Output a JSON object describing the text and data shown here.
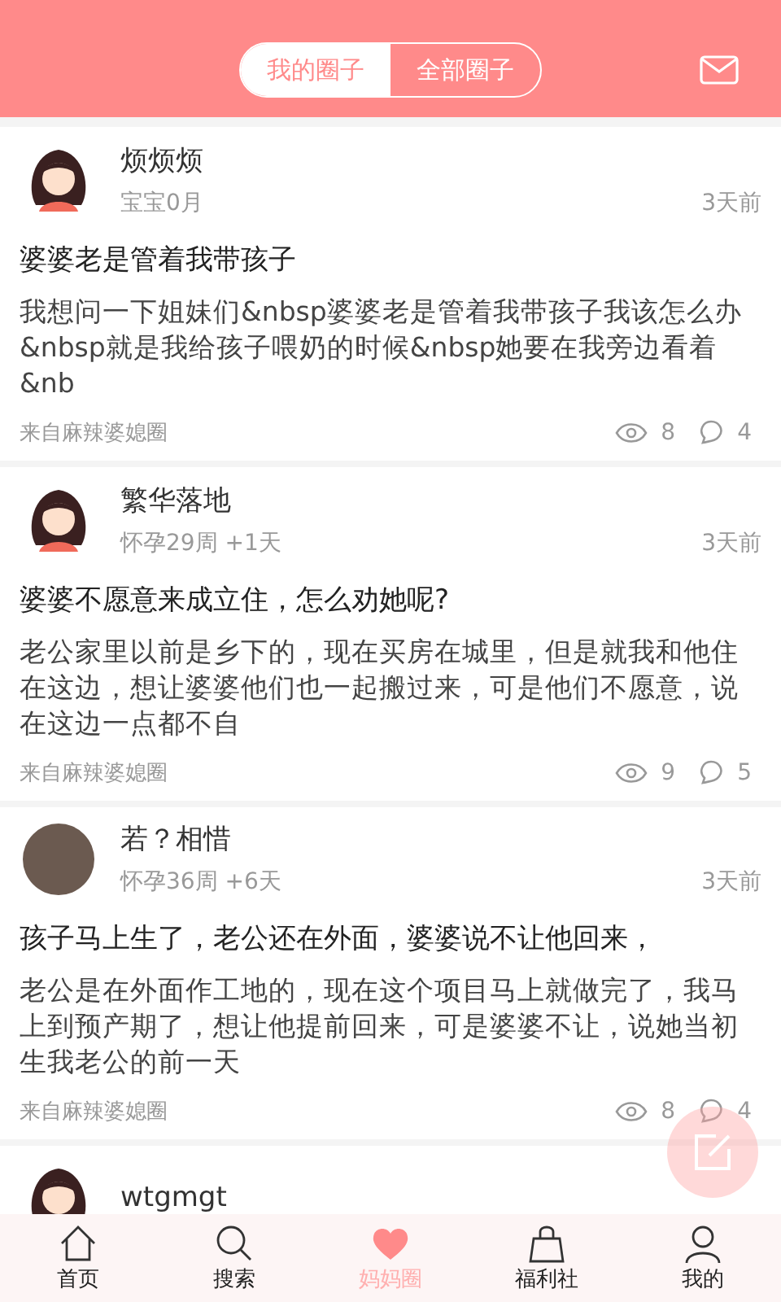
{
  "header": {
    "tabs": [
      {
        "label": "我的圈子",
        "selected": true
      },
      {
        "label": "全部圈子",
        "selected": false
      }
    ]
  },
  "posts": [
    {
      "kind": "cartoon",
      "name": "烦烦烦",
      "stage": "宝宝0月",
      "time": "3天前",
      "title": "婆婆老是管着我带孩子",
      "body": "我想问一下姐妹们&nbsp婆婆老是管着我带孩子我该怎么办&nbsp就是我给孩子喂奶的时候&nbsp她要在我旁边看着&nb",
      "source": "来自麻辣婆媳圈",
      "views": "8",
      "comments": "4"
    },
    {
      "kind": "cartoon",
      "name": "繁华落地",
      "stage": "怀孕29周 +1天",
      "time": "3天前",
      "title": "婆婆不愿意来成立住，怎么劝她呢?",
      "body": "老公家里以前是乡下的，现在买房在城里，但是就我和他住在这边，想让婆婆他们也一起搬过来，可是他们不愿意，说在这边一点都不自",
      "source": "来自麻辣婆媳圈",
      "views": "9",
      "comments": "5"
    },
    {
      "kind": "photo",
      "name": "若？相惜",
      "stage": "怀孕36周 +6天",
      "time": "3天前",
      "title": "孩子马上生了，老公还在外面，婆婆说不让他回来，",
      "body": "老公是在外面作工地的，现在这个项目马上就做完了，我马上到预产期了，想让他提前回来，可是婆婆不让，说她当初生我老公的前一天",
      "source": "来自麻辣婆媳圈",
      "views": "8",
      "comments": "4"
    },
    {
      "kind": "cartoon",
      "name": "wtgmgt"
    }
  ],
  "nav": [
    {
      "label": "首页",
      "kind": "home",
      "selected": false
    },
    {
      "label": "搜索",
      "kind": "search",
      "selected": false
    },
    {
      "label": "妈妈圈",
      "kind": "heart",
      "selected": true
    },
    {
      "label": "福利社",
      "kind": "bag",
      "selected": false
    },
    {
      "label": "我的",
      "kind": "user",
      "selected": false
    }
  ]
}
